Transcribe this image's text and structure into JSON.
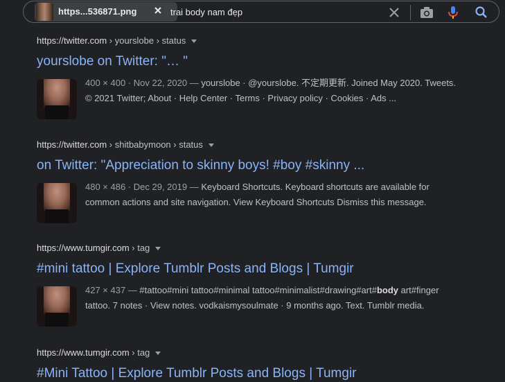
{
  "search": {
    "image_chip_label": "https...536871.png",
    "query": "trai body nam đẹp"
  },
  "results": [
    {
      "site": "https://twitter.com",
      "path": " › yourslobe › status",
      "title": "yourslobe on Twitter: \"… \"",
      "meta": "400 × 400 · Nov 22, 2020 — ",
      "snippet_pre": "yourslobe · @yourslobe. 不定期更新. Joined May 2020. Tweets. © 2021 Twitter; About · Help Center · Terms · Privacy policy · Cookies · Ads ...",
      "snippet_bold": "",
      "snippet_post": ""
    },
    {
      "site": "https://twitter.com",
      "path": " › shitbabymoon › status",
      "title": "on Twitter: \"Appreciation to skinny boys! #boy #skinny ...",
      "meta": "480 × 486 · Dec 29, 2019 — ",
      "snippet_pre": "Keyboard Shortcuts. Keyboard shortcuts are available for common actions and site navigation. View Keyboard Shortcuts Dismiss this message.",
      "snippet_bold": "",
      "snippet_post": ""
    },
    {
      "site": "https://www.tumgir.com",
      "path": " › tag",
      "title": "#mini tattoo | Explore Tumblr Posts and Blogs | Tumgir",
      "meta": "427 × 437 — ",
      "snippet_pre": "#tattoo#mini tattoo#minimal tattoo#minimalist#drawing#art#",
      "snippet_bold": "body",
      "snippet_post": " art#finger tattoo. 7 notes · View notes. vodkaismysoulmate · 9 months ago. Text. Tumblr media."
    },
    {
      "site": "https://www.tumgir.com",
      "path": " › tag",
      "title": "#Mini Tattoo | Explore Tumblr Posts and Blogs | Tumgir",
      "meta": "",
      "snippet_pre": "",
      "snippet_bold": "",
      "snippet_post": ""
    }
  ]
}
